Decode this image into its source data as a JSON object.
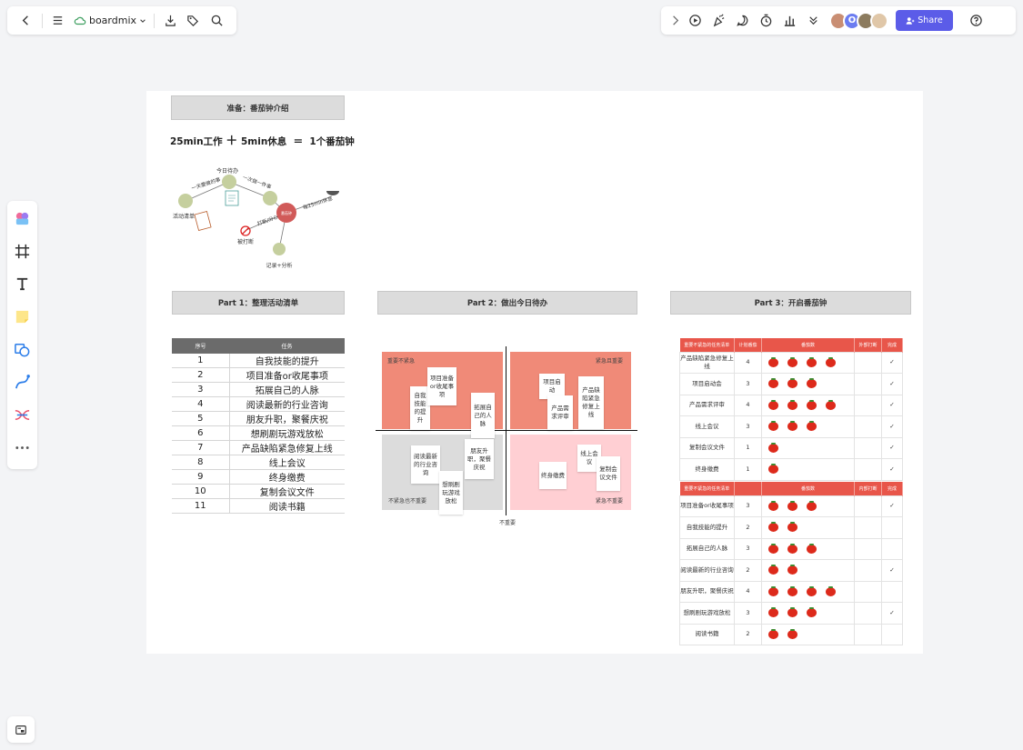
{
  "toolbar": {
    "brand": "boardmix",
    "share_label": "Share",
    "avatar_o": "O"
  },
  "canvas": {
    "prep_title": "准备：番茄钟介绍",
    "formula": {
      "work": "25min工作",
      "plus": "＋",
      "rest": "5min休息",
      "equals": "＝",
      "result": "1个番茄钟"
    },
    "mindmap": {
      "center": "番茄钟",
      "nodes": [
        "今日待办",
        "一天要做的事",
        "活动清单",
        "一次做一件事",
        "打断/分心",
        "被打断",
        "每25min休息",
        "记录+分析"
      ]
    },
    "part1_title": "Part 1：整理活动清单",
    "part2_title": "Part 2：做出今日待办",
    "part3_title": "Part 3：开启番茄钟"
  },
  "task_table": {
    "headers": [
      "序号",
      "任务"
    ],
    "rows": [
      [
        "1",
        "自我技能的提升"
      ],
      [
        "2",
        "项目准备or收尾事项"
      ],
      [
        "3",
        "拓展自己的人脉"
      ],
      [
        "4",
        "阅读最新的行业咨询"
      ],
      [
        "5",
        "朋友升职，聚餐庆祝"
      ],
      [
        "6",
        "想刷剧玩游戏放松"
      ],
      [
        "7",
        "产品缺陷紧急修复上线"
      ],
      [
        "8",
        "线上会议"
      ],
      [
        "9",
        "终身缴费"
      ],
      [
        "10",
        "复制会议文件"
      ],
      [
        "11",
        "阅读书籍"
      ]
    ]
  },
  "matrix": {
    "q1": "重要不紧急",
    "q2": "紧急且重要",
    "q3": "不紧急也不重要",
    "q4": "紧急不重要",
    "axis": "不重要",
    "notes": {
      "n1": "自我技能的提升",
      "n2": "项目准备or收尾事项",
      "n3": "拓展自己的人脉",
      "n4": "项目启动",
      "n5": "产品需求评审",
      "n6": "产品缺陷紧急修复上线",
      "n7": "阅读最新的行业咨询",
      "n8": "想刷剧玩游戏放松",
      "n9": "朋友升职，聚餐庆祝",
      "n10": "终身缴费",
      "n11": "线上会议",
      "n12": "复制会议文件"
    }
  },
  "pomodoro": {
    "section1_headers": [
      "重要不紧急的任务清单",
      "计划番茄",
      "番茄数",
      "",
      "",
      "",
      "外部打断",
      "完成"
    ],
    "section1_rows": [
      {
        "task": "产品缺陷紧急修复上线",
        "plan": "4",
        "count": 4,
        "done": "✓"
      },
      {
        "task": "项目启动会",
        "plan": "3",
        "count": 3,
        "done": "✓"
      },
      {
        "task": "产品需求评审",
        "plan": "4",
        "count": 4,
        "done": "✓"
      },
      {
        "task": "线上会议",
        "plan": "3",
        "count": 3,
        "done": "✓"
      },
      {
        "task": "复制会议文件",
        "plan": "1",
        "count": 1,
        "done": "✓"
      },
      {
        "task": "终身缴费",
        "plan": "1",
        "count": 1,
        "done": "✓"
      }
    ],
    "section2_headers": [
      "重要不紧急的任务清单",
      "",
      "番茄数",
      "",
      "",
      "",
      "内部打断",
      "完成"
    ],
    "section2_rows": [
      {
        "task": "项目准备or收尾事项",
        "plan": "3",
        "count": 3,
        "done": "✓"
      },
      {
        "task": "自我技能的提升",
        "plan": "2",
        "count": 2,
        "done": ""
      },
      {
        "task": "拓展自己的人脉",
        "plan": "3",
        "count": 3,
        "done": ""
      },
      {
        "task": "阅读最新的行业咨询",
        "plan": "2",
        "count": 2,
        "done": "✓"
      },
      {
        "task": "朋友升职，聚餐庆祝",
        "plan": "4",
        "count": 4,
        "done": ""
      },
      {
        "task": "想刷剧玩游戏放松",
        "plan": "3",
        "count": 3,
        "done": "✓"
      },
      {
        "task": "阅读书籍",
        "plan": "2",
        "count": 2,
        "done": ""
      }
    ]
  },
  "colors": {
    "accent": "#5b5ce8",
    "matrix_red": "#f08a78",
    "matrix_grey": "#dcdcdc",
    "matrix_pink": "#ffcfd3",
    "tomato": "#dd2a1b"
  }
}
